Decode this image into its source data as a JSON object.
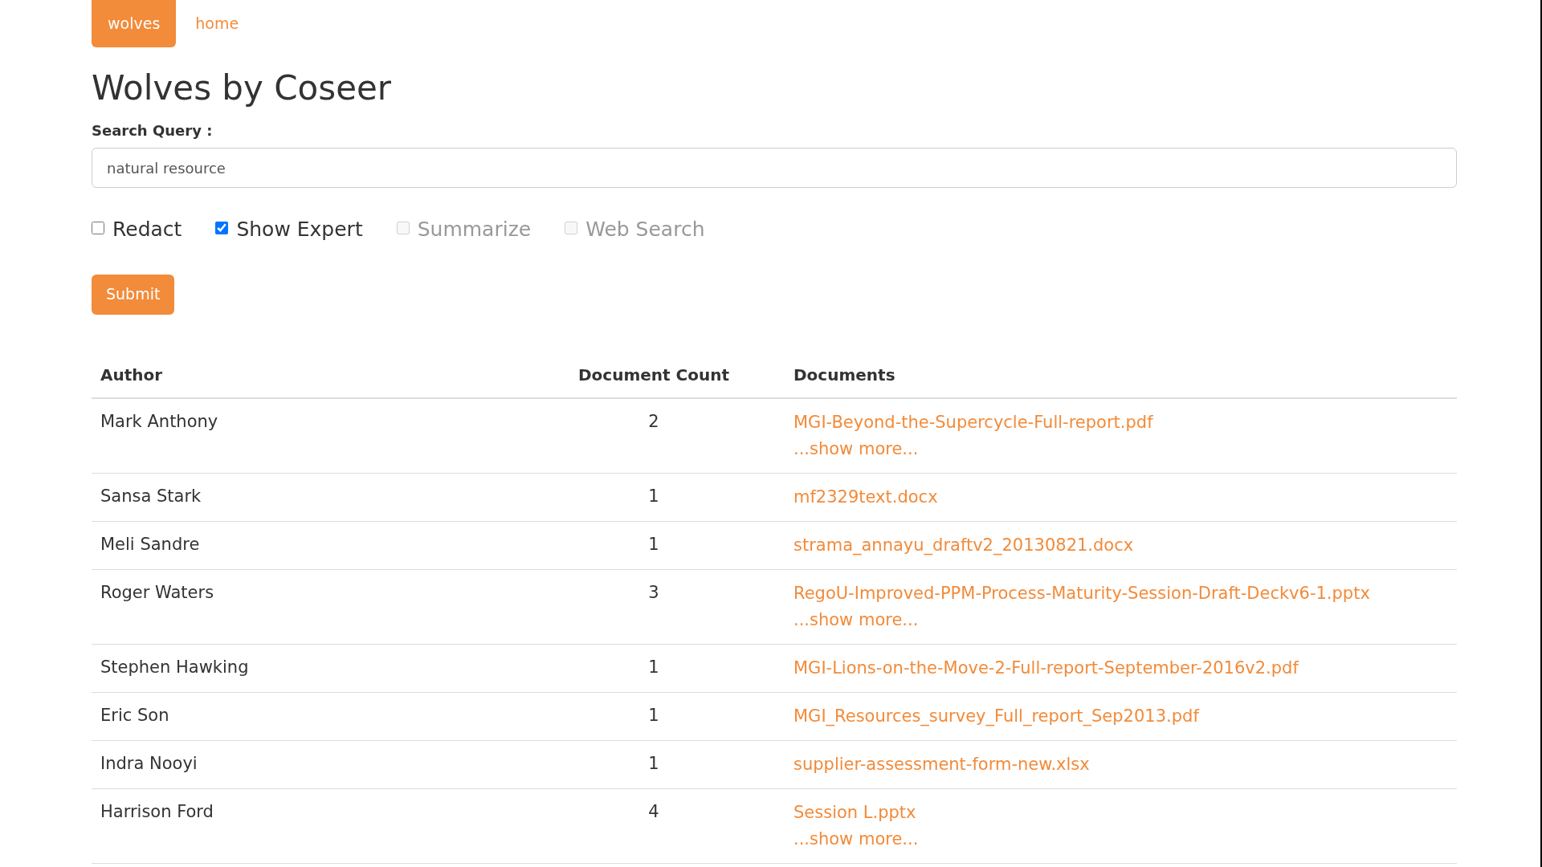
{
  "nav": [
    {
      "label": "wolves",
      "selected": true
    },
    {
      "label": "home",
      "selected": false
    }
  ],
  "title": "Wolves by Coseer",
  "search": {
    "label": "Search Query :",
    "value": "natural resource"
  },
  "options": [
    {
      "label": "Redact",
      "checked": false,
      "disabled": false
    },
    {
      "label": "Show Expert",
      "checked": true,
      "disabled": false
    },
    {
      "label": "Summarize",
      "checked": false,
      "disabled": true
    },
    {
      "label": "Web Search",
      "checked": false,
      "disabled": true
    }
  ],
  "submit": "Submit",
  "table": {
    "columns": [
      "Author",
      "Document Count",
      "Documents"
    ],
    "rows": [
      {
        "author": "Mark Anthony",
        "count": "2",
        "document": "MGI-Beyond-the-Supercycle-Full-report.pdf",
        "more": "...show more..."
      },
      {
        "author": "Sansa Stark",
        "count": "1",
        "document": "mf2329text.docx"
      },
      {
        "author": "Meli Sandre",
        "count": "1",
        "document": "strama_annayu_draftv2_20130821.docx"
      },
      {
        "author": "Roger Waters",
        "count": "3",
        "document": "RegoU-Improved-PPM-Process-Maturity-Session-Draft-Deckv6-1.pptx",
        "more": "...show more..."
      },
      {
        "author": "Stephen Hawking",
        "count": "1",
        "document": "MGI-Lions-on-the-Move-2-Full-report-September-2016v2.pdf"
      },
      {
        "author": "Eric Son",
        "count": "1",
        "document": "MGI_Resources_survey_Full_report_Sep2013.pdf"
      },
      {
        "author": "Indra Nooyi",
        "count": "1",
        "document": "supplier-assessment-form-new.xlsx"
      },
      {
        "author": "Harrison Ford",
        "count": "4",
        "document": "Session L.pptx",
        "more": "...show more..."
      }
    ]
  }
}
